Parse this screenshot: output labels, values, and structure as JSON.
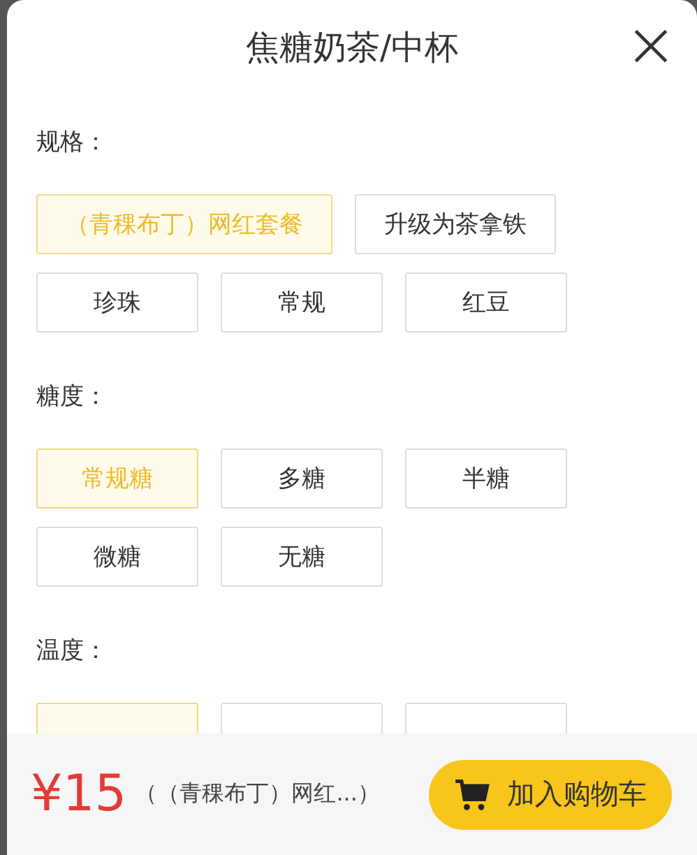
{
  "dialog": {
    "title": "焦糖奶茶/中杯"
  },
  "sections": [
    {
      "label": "规格：",
      "options": [
        {
          "label": "（青稞布丁）网红套餐",
          "selected": true
        },
        {
          "label": "升级为茶拿铁",
          "selected": false
        },
        {
          "label": "珍珠",
          "selected": false
        },
        {
          "label": "常规",
          "selected": false
        },
        {
          "label": "红豆",
          "selected": false
        }
      ]
    },
    {
      "label": "糖度：",
      "options": [
        {
          "label": "常规糖",
          "selected": true
        },
        {
          "label": "多糖",
          "selected": false
        },
        {
          "label": "半糖",
          "selected": false
        },
        {
          "label": "微糖",
          "selected": false
        },
        {
          "label": "无糖",
          "selected": false
        }
      ]
    },
    {
      "label": "温度：",
      "options": [
        {
          "selected": true
        },
        {
          "selected": false
        },
        {
          "selected": false
        }
      ]
    }
  ],
  "footer": {
    "price": "¥15",
    "summary": "（（青稞布丁）网红...）",
    "add_button": "加入购物车"
  }
}
